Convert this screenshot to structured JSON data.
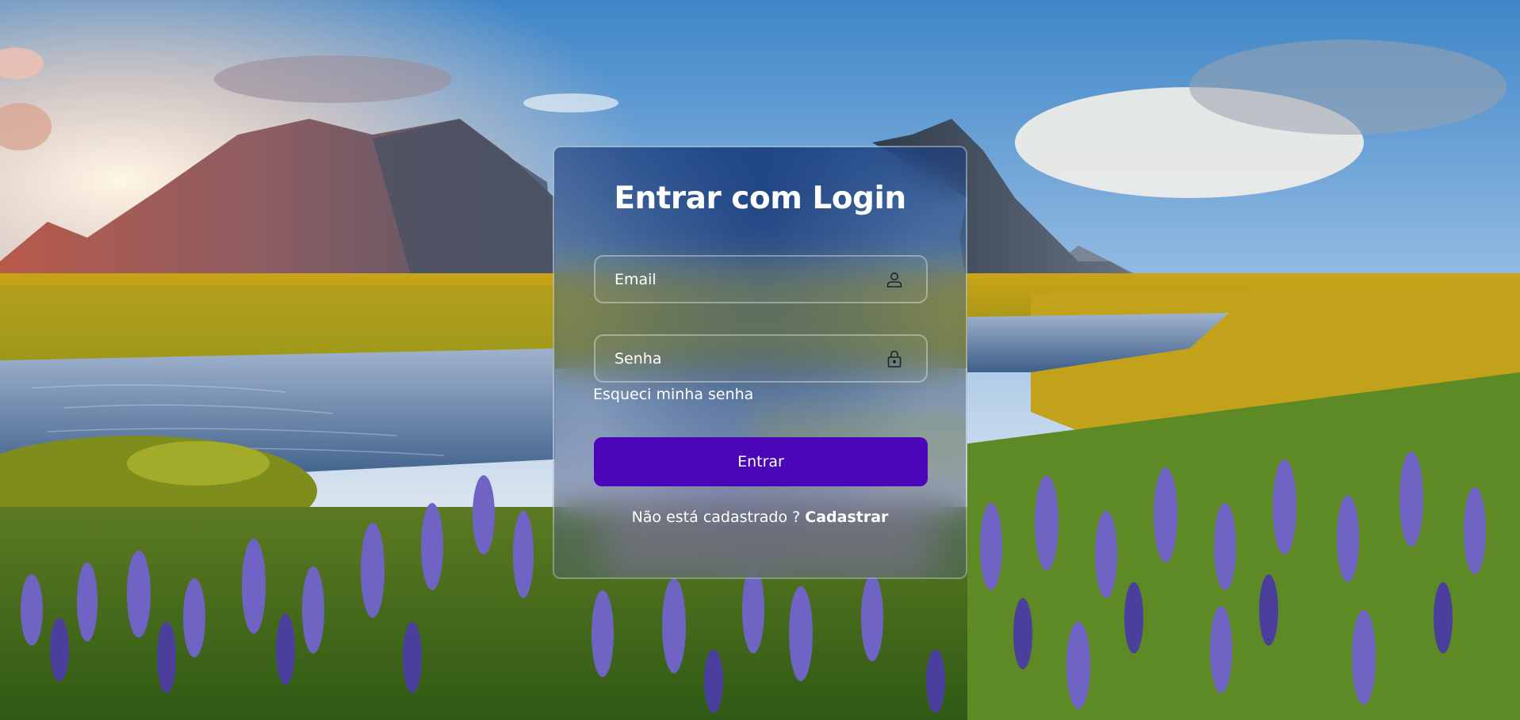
{
  "background": {
    "scene": "landscape-mountains-lake-lupines"
  },
  "login": {
    "title": "Entrar com Login",
    "email": {
      "placeholder": "Email",
      "value": "",
      "icon": "user-icon"
    },
    "senha": {
      "placeholder": "Senha",
      "value": "",
      "icon": "lock-icon"
    },
    "forgot_label": "Esqueci minha senha",
    "submit_label": "Entrar",
    "register_prompt": "Não está cadastrado ? ",
    "register_link": "Cadastrar"
  },
  "colors": {
    "button": "#4a06b7",
    "text": "#ffffff"
  }
}
